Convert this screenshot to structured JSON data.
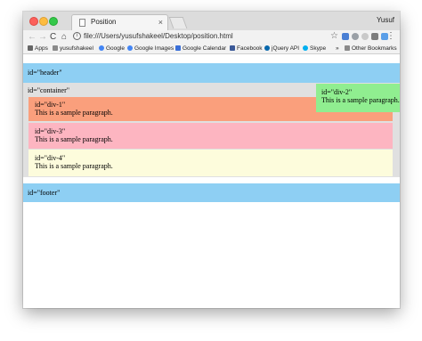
{
  "browser": {
    "tab_title": "Position",
    "tab_close": "×",
    "profile_name": "Yusuf",
    "nav": {
      "back": "←",
      "forward": "→",
      "reload": "C",
      "home": "⌂"
    },
    "url": "file:///Users/yusufshakeel/Desktop/position.html",
    "star": "☆",
    "menu": "⋮",
    "bookmarks": [
      {
        "label": "Apps",
        "icon": "apps-grid-icon",
        "color": "#666666"
      },
      {
        "label": "yusufshakeel",
        "icon": "folder-icon",
        "color": "#7a7a7a"
      },
      {
        "label": "Google",
        "icon": "google-icon",
        "color": "#4285f4"
      },
      {
        "label": "Google Images",
        "icon": "google-icon",
        "color": "#4285f4"
      },
      {
        "label": "Google Calendar",
        "icon": "calendar-icon",
        "color": "#3a6fd8"
      },
      {
        "label": "Facebook",
        "icon": "facebook-icon",
        "color": "#3b5998"
      },
      {
        "label": "jQuery API",
        "icon": "jquery-icon",
        "color": "#0868ac"
      },
      {
        "label": "Skype",
        "icon": "skype-icon",
        "color": "#00aff0"
      }
    ],
    "bookmarks_more": "»",
    "other_bookmarks": "Other Bookmarks"
  },
  "page": {
    "header": "id=\"header\"",
    "container": "id=\"container\"",
    "div1": {
      "id_text": "id=\"div-1\"",
      "paragraph": "This is a sample paragraph."
    },
    "div2": {
      "id_text": "id=\"div-2\"",
      "paragraph": "This is a sample paragraph."
    },
    "div3": {
      "id_text": "id=\"div-3\"",
      "paragraph": "This is a sample paragraph."
    },
    "div4": {
      "id_text": "id=\"div-4\"",
      "paragraph": "This is a sample paragraph."
    },
    "footer": "id=\"footer\""
  },
  "colors": {
    "header_bg": "#8ecff3",
    "container_bg": "#e0e0e0",
    "div1_bg": "#fa9f7c",
    "div2_bg": "#90ee90",
    "div3_bg": "#fdb5c1",
    "div4_bg": "#fdfcdc",
    "footer_bg": "#8ecff3"
  }
}
